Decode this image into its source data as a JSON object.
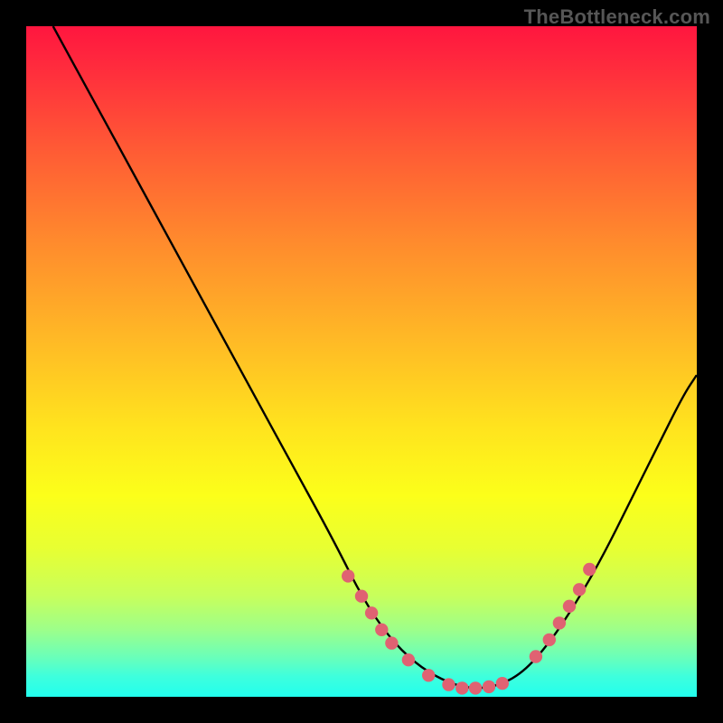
{
  "watermark": "TheBottleneck.com",
  "chart_data": {
    "type": "line",
    "title": "",
    "xlabel": "",
    "ylabel": "",
    "xlim": [
      0,
      100
    ],
    "ylim": [
      0,
      100
    ],
    "series": [
      {
        "name": "curve",
        "x": [
          4,
          10,
          16,
          22,
          28,
          34,
          40,
          46,
          50,
          54,
          58,
          62,
          66,
          70,
          74,
          78,
          82,
          86,
          90,
          94,
          98,
          100
        ],
        "y": [
          100,
          89,
          78,
          67,
          56,
          45,
          34,
          23,
          15,
          9,
          5,
          2.5,
          1.2,
          1.5,
          3.5,
          8,
          14,
          21,
          29,
          37,
          45,
          48
        ]
      }
    ],
    "markers": [
      {
        "x": 48,
        "y": 18
      },
      {
        "x": 50,
        "y": 15
      },
      {
        "x": 51.5,
        "y": 12.5
      },
      {
        "x": 53,
        "y": 10
      },
      {
        "x": 54.5,
        "y": 8
      },
      {
        "x": 57,
        "y": 5.5
      },
      {
        "x": 60,
        "y": 3.2
      },
      {
        "x": 63,
        "y": 1.8
      },
      {
        "x": 65,
        "y": 1.3
      },
      {
        "x": 67,
        "y": 1.3
      },
      {
        "x": 69,
        "y": 1.5
      },
      {
        "x": 71,
        "y": 2
      },
      {
        "x": 76,
        "y": 6
      },
      {
        "x": 78,
        "y": 8.5
      },
      {
        "x": 79.5,
        "y": 11
      },
      {
        "x": 81,
        "y": 13.5
      },
      {
        "x": 82.5,
        "y": 16
      },
      {
        "x": 84,
        "y": 19
      }
    ]
  }
}
